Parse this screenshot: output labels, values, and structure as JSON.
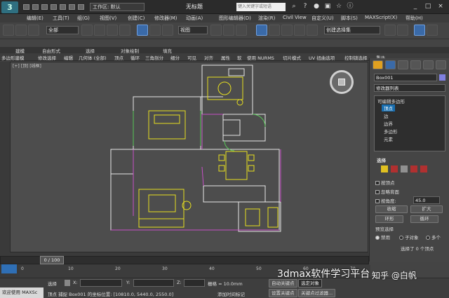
{
  "title_bar": {
    "workspace": "工作区: 默认",
    "window_title": "无标题",
    "search_placeholder": "键入关键字或短语"
  },
  "menu": [
    "编辑(E)",
    "工具(T)",
    "组(G)",
    "视图(V)",
    "创建(C)",
    "修改器(M)",
    "动画(A)",
    "图形编辑器(D)",
    "渲染(R)",
    "Civil View",
    "自定义(U)",
    "脚本(S)",
    "MAXScript(X)",
    "帮助(H)"
  ],
  "toolbar": {
    "filter": "全部",
    "ref_coord": "视图",
    "named_sel": "创建选择集"
  },
  "ribbon_tabs": [
    "建模",
    "自由形式",
    "选择",
    "对象绘制",
    "填充"
  ],
  "ribbon_items": [
    "多边形建模",
    "修改选择",
    "编辑",
    "几何体 (全部)",
    "顶点",
    "循环",
    "三角剖分",
    "细分",
    "可见",
    "对齐",
    "属性",
    "软",
    "使用 NURMS",
    "切片模式",
    "UV 扭曲选项",
    "控制锁选择",
    "重选"
  ],
  "viewport": {
    "label": "[+] [顶] [线框]"
  },
  "command_panel": {
    "object_name": "Box001",
    "modifier_list": "修改器列表",
    "stack": [
      "可编辑多边形",
      "顶点",
      "边",
      "边界",
      "多边形",
      "元素"
    ],
    "selected_stack_item": "顶点",
    "select_header": "选择",
    "by_vertex": "按顶点",
    "ignore_backface": "忽略背面",
    "by_angle": "按角度:",
    "angle_value": "45.0",
    "shrink": "收缩",
    "grow": "扩大",
    "ring": "环形",
    "loop": "循环",
    "preview_selection": "预览选择",
    "disabled": "禁用",
    "subobject": "子对象",
    "multiple": "多个",
    "selected_count": "选择了 0 个顶点"
  },
  "timeline": {
    "slider": "0 / 100",
    "ticks": [
      "0",
      "10",
      "20",
      "30",
      "40",
      "50",
      "60",
      "70"
    ]
  },
  "status": {
    "maxscript": "欢迎使用 MAXSc",
    "select_label": "选择",
    "coords_prefix": "X:",
    "coords_y": "Y:",
    "coords_z": "Z:",
    "grid": "栅格 = 10.0mm",
    "prompt": "顶点 捕捉 Box001 的坐标位置: [10810.0, 5440.0, 2550.0]",
    "add_time_tag": "添加时间标记",
    "auto_key": "自动关键点",
    "selected_objects": "选定对象",
    "set_key": "设置关键点",
    "key_filters": "关键点过滤器..."
  },
  "watermark": {
    "text1": "3dmax软件学习平台",
    "text2": "知乎 @白帆"
  }
}
